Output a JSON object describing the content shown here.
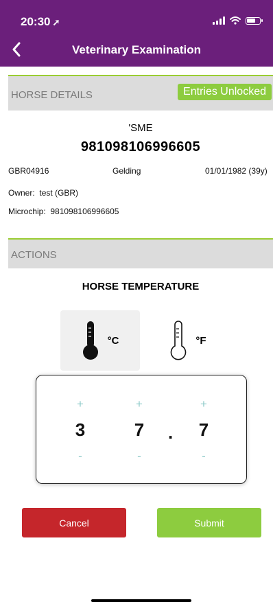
{
  "status_bar": {
    "time": "20:30",
    "location_arrow": "➚"
  },
  "nav": {
    "title": "Veterinary Examination",
    "back_icon": "chevron-left-icon"
  },
  "horse_details": {
    "section_label": "HORSE DETAILS",
    "badge": "Entries Unlocked",
    "name": "'SME",
    "id": "981098106996605",
    "reg_no": "GBR04916",
    "sex": "Gelding",
    "dob": "01/01/1982 (39y)",
    "owner_label": "Owner:",
    "owner": "test (GBR)",
    "microchip_label": "Microchip:",
    "microchip": "981098106996605"
  },
  "actions": {
    "section_label": "ACTIONS",
    "temperature_title": "HORSE TEMPERATURE",
    "units": [
      {
        "label": "°C",
        "selected": true,
        "icon": "thermometer-full-icon"
      },
      {
        "label": "°F",
        "selected": false,
        "icon": "thermometer-empty-icon"
      }
    ]
  },
  "picker": {
    "increment_label": "+",
    "decrement_label": "-",
    "digits": [
      "3",
      "7",
      "7"
    ],
    "decimal_point": "."
  },
  "buttons": {
    "cancel": "Cancel",
    "submit": "Submit"
  },
  "colors": {
    "header": "#6b1f7b",
    "accent_green": "#8dcc3f",
    "cancel_red": "#c5262b",
    "stepper_teal": "#8cc9c8"
  }
}
